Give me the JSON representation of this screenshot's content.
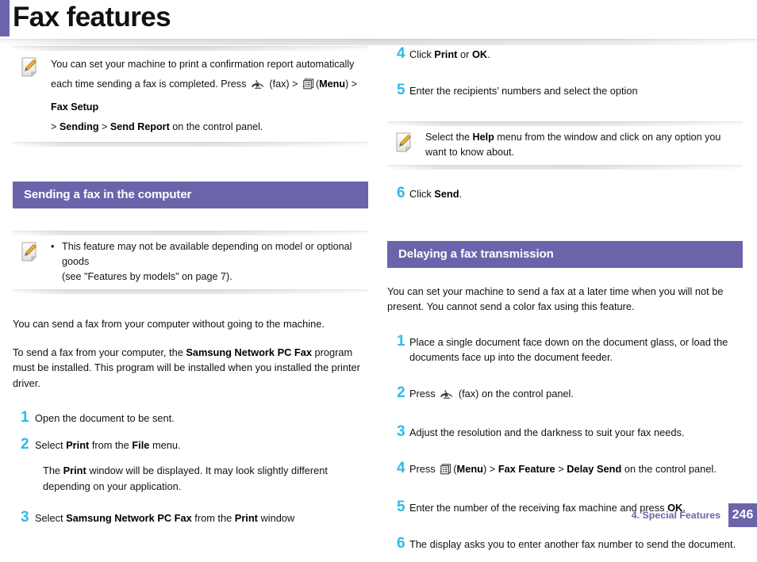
{
  "page": {
    "title": "Fax features",
    "accent_color": "#6b64ab",
    "step_number_color": "#2fbbe8"
  },
  "icons": {
    "note": "note-pencil-icon",
    "fax": "fax-machine-icon",
    "menu": "menu-list-icon"
  },
  "left_column": {
    "note_top": {
      "text_part1": "You can set your machine to print a confirmation report automatically each time sending a fax is completed. Press",
      "fax_label": "(fax) >",
      "menu_label_open": "(",
      "menu_bold": "Menu",
      "menu_label_close": ") >",
      "bold1": "Fax Setup",
      "sep1": "> ",
      "bold2": "Sending",
      "sep2": " > ",
      "bold3": "Send Report",
      "tail": " on the control panel."
    },
    "section_heading": "Sending a fax in the computer",
    "note_bullet": {
      "bullet": "•",
      "line1": "This feature may not be available depending on model or optional goods",
      "line2": "(see \"Features by models\" on page 7)."
    },
    "para1": "You can send a fax from your computer without going to the machine.",
    "para2_pre": "To send a fax from your computer, the ",
    "para2_bold": "Samsung Network PC Fax",
    "para2_post": " program must be installed. This program will be installed when you installed the printer driver.",
    "steps": [
      {
        "num": "1",
        "text": "Open the document to be sent."
      },
      {
        "num": "2",
        "pre": "Select ",
        "b1": "Print",
        "mid": " from the ",
        "b2": "File",
        "post": " menu.",
        "sub_pre": "The ",
        "sub_b": "Print",
        "sub_post": " window will be displayed. It may look slightly different depending on your application."
      },
      {
        "num": "3",
        "pre": "Select ",
        "b1": "Samsung Network PC Fax",
        "mid": " from the ",
        "b2": "Print",
        "post": " window"
      }
    ]
  },
  "right_column": {
    "steps_top": [
      {
        "num": "4",
        "pre": "Click ",
        "b1": "Print",
        "mid": " or ",
        "b2": "OK",
        "post": "."
      },
      {
        "num": "5",
        "pre": "Enter the recipients’ numbers and select the option"
      }
    ],
    "note_help": {
      "pre": "Select the ",
      "bold": "Help",
      "post": " menu from the window and click on any option you want to know about."
    },
    "step_six": {
      "num": "6",
      "pre": "Click ",
      "b1": "Send",
      "post": "."
    },
    "section_heading": "Delaying a fax transmission",
    "para1": "You can set your machine to send a fax at a later time when you will not be present. You cannot send a color fax using this feature.",
    "steps": [
      {
        "num": "1",
        "text": "Place a single document face down on the document glass, or load the documents face up into the document feeder."
      },
      {
        "num": "2",
        "pre": "Press ",
        "icon": "fax",
        "post": " (fax) on the control panel."
      },
      {
        "num": "3",
        "text": "Adjust the resolution and the darkness to suit your fax needs."
      },
      {
        "num": "4",
        "pre": "Press ",
        "icon": "menu",
        "open": "(",
        "b1": "Menu",
        "close": ") > ",
        "b2": "Fax Feature",
        "mid": " > ",
        "b3": "Delay Send",
        "post": " on the control panel."
      },
      {
        "num": "5",
        "pre": "Enter the number of the receiving fax machine and press ",
        "b1": "OK",
        "post": "."
      },
      {
        "num": "6",
        "text": "The display asks you to enter another fax number to send the document."
      }
    ]
  },
  "footer": {
    "label": "4.  Special Features",
    "page_number": "246"
  }
}
